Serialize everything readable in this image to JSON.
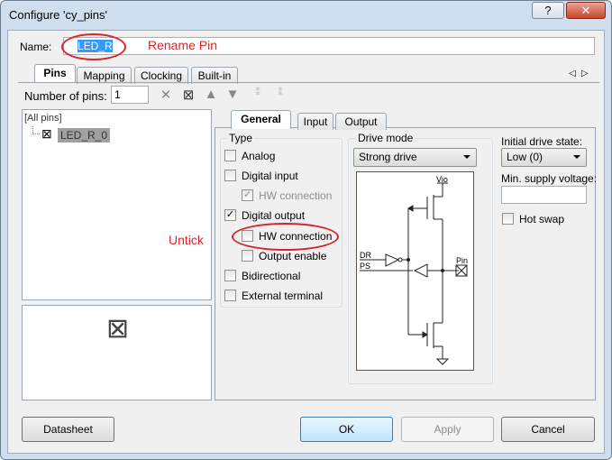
{
  "window": {
    "title": "Configure 'cy_pins'",
    "help_label": "?",
    "close_label": "✕"
  },
  "name": {
    "label": "Name:",
    "value": "LED_R"
  },
  "annotations": {
    "rename": "Rename Pin",
    "untick": "Untick"
  },
  "tabs": [
    {
      "label": "Pins"
    },
    {
      "label": "Mapping"
    },
    {
      "label": "Clocking"
    },
    {
      "label": "Built-in"
    }
  ],
  "tab_scroll": {
    "left": "◁",
    "right": "▷"
  },
  "toolbar": {
    "num_pins_label": "Number of pins:",
    "num_pins_value": "1"
  },
  "tree": {
    "root": "[All pins]",
    "item": "LED_R_0"
  },
  "subtabs": [
    {
      "label": "General"
    },
    {
      "label": "Input"
    },
    {
      "label": "Output"
    }
  ],
  "type_group": {
    "title": "Type",
    "items": [
      {
        "label": "Analog",
        "checked": false,
        "disabled": false
      },
      {
        "label": "Digital input",
        "checked": false,
        "disabled": false
      },
      {
        "label": "HW connection",
        "checked": true,
        "disabled": true
      },
      {
        "label": "Digital output",
        "checked": true,
        "disabled": false
      },
      {
        "label": "HW connection",
        "checked": false,
        "disabled": false
      },
      {
        "label": "Output enable",
        "checked": false,
        "disabled": false
      },
      {
        "label": "Bidirectional",
        "checked": false,
        "disabled": false
      },
      {
        "label": "External terminal",
        "checked": false,
        "disabled": false
      }
    ]
  },
  "drive_mode": {
    "title": "Drive mode",
    "value": "Strong drive",
    "diagram": {
      "vio": "Vio",
      "dr": "DR",
      "ps": "PS",
      "pin": "Pin"
    }
  },
  "initial_state": {
    "label": "Initial drive state:",
    "value": "Low (0)"
  },
  "min_supply": {
    "label": "Min. supply voltage:",
    "value": ""
  },
  "hot_swap": {
    "label": "Hot swap",
    "checked": false
  },
  "buttons": {
    "datasheet": "Datasheet",
    "ok": "OK",
    "apply": "Apply",
    "cancel": "Cancel"
  }
}
